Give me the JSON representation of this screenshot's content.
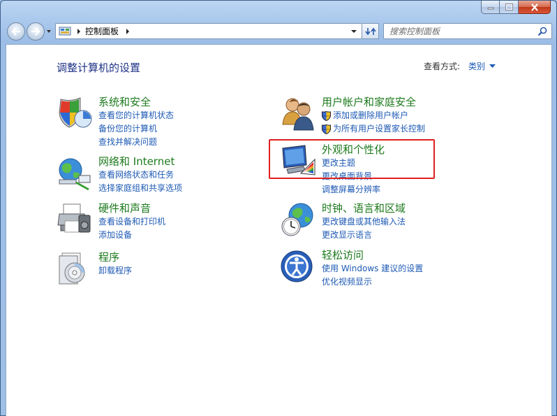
{
  "address": {
    "crumb": "控制面板"
  },
  "search": {
    "placeholder": "搜索控制面板"
  },
  "page": {
    "title": "调整计算机的设置"
  },
  "viewby": {
    "label": "查看方式:",
    "value": "类别"
  },
  "categories": {
    "system": {
      "title": "系统和安全",
      "icon": "shield-icon",
      "links": [
        "查看您的计算机状态",
        "备份您的计算机",
        "查找并解决问题"
      ]
    },
    "network": {
      "title": "网络和 Internet",
      "icon": "network-globe-icon",
      "links": [
        "查看网络状态和任务",
        "选择家庭组和共享选项"
      ]
    },
    "hardware": {
      "title": "硬件和声音",
      "icon": "printer-icon",
      "links": [
        "查看设备和打印机",
        "添加设备"
      ]
    },
    "programs": {
      "title": "程序",
      "icon": "programs-disc-icon",
      "links": [
        "卸载程序"
      ]
    },
    "users": {
      "title": "用户帐户和家庭安全",
      "icon": "users-icon",
      "links": [
        "添加或删除用户帐户",
        "为所有用户设置家长控制"
      ]
    },
    "appearance": {
      "title": "外观和个性化",
      "icon": "monitor-palette-icon",
      "links": [
        "更改主题",
        "更改桌面背景",
        "调整屏幕分辨率"
      ]
    },
    "clock": {
      "title": "时钟、语言和区域",
      "icon": "clock-globe-icon",
      "links": [
        "更改键盘或其他输入法",
        "更改显示语言"
      ]
    },
    "ease": {
      "title": "轻松访问",
      "icon": "ease-of-access-icon",
      "links": [
        "使用 Windows 建议的设置",
        "优化视频显示"
      ]
    }
  },
  "colors": {
    "accent_link": "#1e5ab4",
    "category_title": "#1d7a1d",
    "highlight": "#e02020"
  }
}
